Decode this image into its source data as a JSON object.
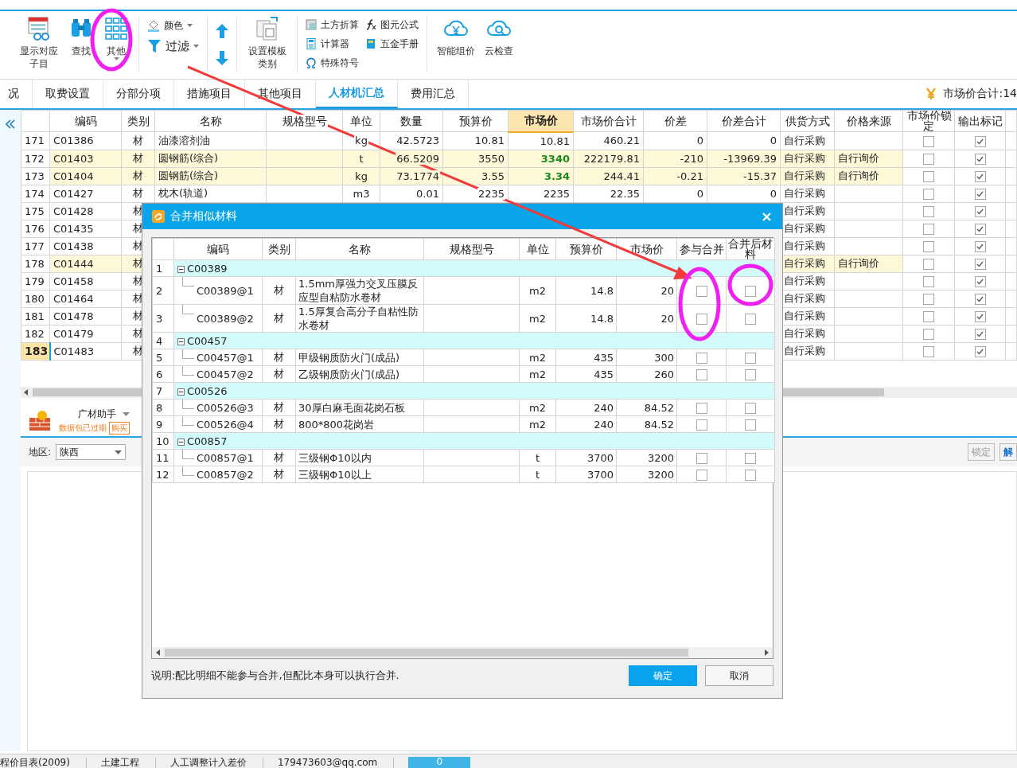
{
  "toolbar": {
    "show_children": "显示对应子目",
    "find": "查找",
    "other": "其他",
    "color_button": "颜色",
    "filter": "过滤",
    "template": "设置模板类别",
    "earthwork": "土方折算",
    "calculator": "计算器",
    "symbols": "特殊符号",
    "formula": "图元公式",
    "hardware": "五金手册",
    "smart_price": "智能组价",
    "cloud_check": "云检查"
  },
  "tabs": [
    {
      "label": "况",
      "selected": false
    },
    {
      "label": "取费设置",
      "selected": false
    },
    {
      "label": "分部分项",
      "selected": false
    },
    {
      "label": "措施项目",
      "selected": false
    },
    {
      "label": "其他项目",
      "selected": false
    },
    {
      "label": "人材机汇总",
      "selected": true
    },
    {
      "label": "费用汇总",
      "selected": false
    }
  ],
  "market_total": "市场价合计:14",
  "main_table": {
    "columns": [
      {
        "label": "编码",
        "selected": false
      },
      {
        "label": "类别",
        "selected": false
      },
      {
        "label": "名称",
        "selected": false
      },
      {
        "label": "规格型号",
        "selected": false
      },
      {
        "label": "单位",
        "selected": false
      },
      {
        "label": "数量",
        "selected": false
      },
      {
        "label": "预算价",
        "selected": false
      },
      {
        "label": "市场价",
        "selected": true
      },
      {
        "label": "市场价合计",
        "selected": false
      },
      {
        "label": "价差",
        "selected": false
      },
      {
        "label": "价差合计",
        "selected": false
      },
      {
        "label": "供货方式",
        "selected": false
      },
      {
        "label": "价格来源",
        "selected": false
      },
      {
        "label": "市场价锁定",
        "selected": false
      },
      {
        "label": "输出标记",
        "selected": false
      }
    ],
    "rows": [
      {
        "no": "171",
        "code": "C01386",
        "category": "材",
        "name": "油漆溶剂油",
        "unit": "kg",
        "quantity": "42.5723",
        "budget_price": "10.81",
        "market_price": "10.81",
        "market_total": "460.21",
        "diff": "0",
        "diff_total": "0",
        "supply": "自行采购",
        "price_locked": false,
        "output": true,
        "highlighted": false,
        "adjusted": false,
        "selected": false
      },
      {
        "no": "172",
        "code": "C01403",
        "category": "材",
        "name": "圆钢筋(综合)",
        "unit": "t",
        "quantity": "66.5209",
        "budget_price": "3550",
        "market_price": "3340",
        "market_total": "222179.81",
        "diff": "-210",
        "diff_total": "-13969.39",
        "supply": "自行采购",
        "source": "自行询价",
        "price_locked": false,
        "output": true,
        "highlighted": true,
        "adjusted": true,
        "selected": false
      },
      {
        "no": "173",
        "code": "C01404",
        "category": "材",
        "name": "圆钢筋(综合)",
        "unit": "kg",
        "quantity": "73.1774",
        "budget_price": "3.55",
        "market_price": "3.34",
        "market_total": "244.41",
        "diff": "-0.21",
        "diff_total": "-15.37",
        "supply": "自行采购",
        "source": "自行询价",
        "price_locked": false,
        "output": true,
        "highlighted": true,
        "adjusted": true,
        "selected": false
      },
      {
        "no": "174",
        "code": "C01427",
        "category": "材",
        "name": "枕木(轨道)",
        "unit": "m3",
        "quantity": "0.01",
        "budget_price": "2235",
        "market_price": "2235",
        "market_total": "22.35",
        "diff": "0",
        "diff_total": "0",
        "supply": "自行采购",
        "price_locked": false,
        "output": true,
        "highlighted": false,
        "adjusted": false,
        "selected": false
      },
      {
        "no": "175",
        "code": "C01428",
        "category": "材",
        "supply": "自行采购",
        "price_locked": false,
        "output": true,
        "highlighted": false,
        "adjusted": false,
        "selected": false
      },
      {
        "no": "176",
        "code": "C01435",
        "category": "材",
        "supply": "自行采购",
        "price_locked": false,
        "output": true,
        "highlighted": false,
        "adjusted": false,
        "selected": false
      },
      {
        "no": "177",
        "code": "C01438",
        "category": "材",
        "supply": "自行采购",
        "price_locked": false,
        "output": true,
        "highlighted": false,
        "adjusted": false,
        "selected": false
      },
      {
        "no": "178",
        "code": "C01444",
        "category": "材",
        "supply": "自行采购",
        "source": "自行询价",
        "price_locked": false,
        "output": true,
        "highlighted": true,
        "adjusted": false,
        "selected": false
      },
      {
        "no": "179",
        "code": "C01458",
        "category": "材",
        "supply": "自行采购",
        "price_locked": false,
        "output": true,
        "highlighted": false,
        "adjusted": false,
        "selected": false
      },
      {
        "no": "180",
        "code": "C01464",
        "category": "材",
        "supply": "自行采购",
        "price_locked": false,
        "output": true,
        "highlighted": false,
        "adjusted": false,
        "selected": false
      },
      {
        "no": "181",
        "code": "C01478",
        "category": "材",
        "supply": "自行采购",
        "price_locked": false,
        "output": true,
        "highlighted": false,
        "adjusted": false,
        "selected": false
      },
      {
        "no": "182",
        "code": "C01479",
        "category": "材",
        "supply": "自行采购",
        "price_locked": false,
        "output": true,
        "highlighted": false,
        "adjusted": false,
        "selected": false
      },
      {
        "no": "183",
        "code": "C01483",
        "category": "材",
        "supply": "自行采购",
        "price_locked": false,
        "output": true,
        "highlighted": false,
        "adjusted": false,
        "selected": true
      }
    ]
  },
  "helper": {
    "title": "广材助手",
    "status": "数据包已过期",
    "action": "购买"
  },
  "region": {
    "label": "地区:",
    "value": "陕西"
  },
  "lock_buttons": [
    {
      "label": "锁定",
      "disabled": true
    },
    {
      "label": "解",
      "disabled": false
    }
  ],
  "dialog": {
    "title": "合并相似材料",
    "columns": [
      "编码",
      "类别",
      "名称",
      "规格型号",
      "单位",
      "预算价",
      "市场价",
      "参与合并",
      "合并后材料"
    ],
    "groups": [
      {
        "no": "1",
        "code": "C00389",
        "expanded": true,
        "children": [
          {
            "no": "2",
            "code": "C00389@1",
            "category": "材",
            "name": "1.5mm厚强力交叉压膜反应型自粘防水卷材",
            "unit": "m2",
            "budget_price": "14.8",
            "market_price": "20",
            "merge": false,
            "merged_material": false
          },
          {
            "no": "3",
            "code": "C00389@2",
            "category": "材",
            "name": "1.5厚复合高分子自粘性防水卷材",
            "unit": "m2",
            "budget_price": "14.8",
            "market_price": "20",
            "merge": false,
            "merged_material": false
          }
        ]
      },
      {
        "no": "4",
        "code": "C00457",
        "expanded": true,
        "children": [
          {
            "no": "5",
            "code": "C00457@1",
            "category": "材",
            "name": "甲级钢质防火门(成品)",
            "unit": "m2",
            "budget_price": "435",
            "market_price": "300",
            "merge": false,
            "merged_material": false
          },
          {
            "no": "6",
            "code": "C00457@2",
            "category": "材",
            "name": "乙级钢质防火门(成品)",
            "unit": "m2",
            "budget_price": "435",
            "market_price": "260",
            "merge": false,
            "merged_material": false
          }
        ]
      },
      {
        "no": "7",
        "code": "C00526",
        "expanded": true,
        "children": [
          {
            "no": "8",
            "code": "C00526@3",
            "category": "材",
            "name": "30厚白麻毛面花岗石板",
            "unit": "m2",
            "budget_price": "240",
            "market_price": "84.52",
            "merge": false,
            "merged_material": false
          },
          {
            "no": "9",
            "code": "C00526@4",
            "category": "材",
            "name": "800*800花岗岩",
            "unit": "m2",
            "budget_price": "240",
            "market_price": "84.52",
            "merge": false,
            "merged_material": false
          }
        ]
      },
      {
        "no": "10",
        "code": "C00857",
        "expanded": true,
        "children": [
          {
            "no": "11",
            "code": "C00857@1",
            "category": "材",
            "name": "三级钢Φ10以内",
            "unit": "t",
            "budget_price": "3700",
            "market_price": "3200",
            "merge": false,
            "merged_material": false
          },
          {
            "no": "12",
            "code": "C00857@2",
            "category": "材",
            "name": "三级钢Φ10以上",
            "unit": "t",
            "budget_price": "3700",
            "market_price": "3200",
            "merge": false,
            "merged_material": false
          }
        ]
      }
    ],
    "note": "说明:配比明细不能参与合并,但配比本身可以执行合并.",
    "buttons": [
      {
        "label": "确定",
        "default": true
      },
      {
        "label": "取消",
        "default": false
      }
    ]
  },
  "status_bar": {
    "items": [
      "程价目表(2009)",
      "土建工程",
      "人工调整计入差价",
      "179473603@qq.com"
    ],
    "count": "0"
  }
}
